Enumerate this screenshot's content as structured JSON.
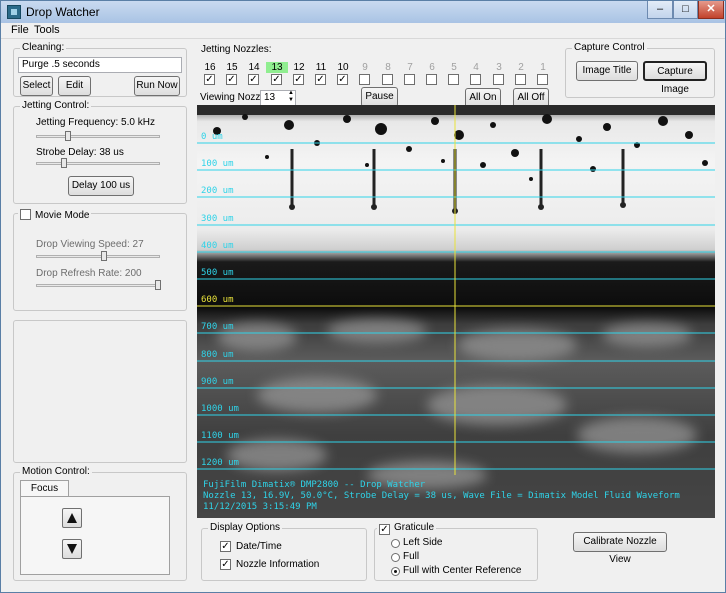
{
  "window": {
    "title": "Drop Watcher",
    "min": "–",
    "max": "□",
    "close": "✕",
    "icon": "app-icon"
  },
  "menu": [
    "File",
    "Tools"
  ],
  "cleaning": {
    "title": "Cleaning:",
    "value": "Purge .5 seconds",
    "select": "Select",
    "edit": "Edit",
    "run_now": "Run Now"
  },
  "jetting_control": {
    "title": "Jetting Control:",
    "frequency_label": "Jetting Frequency:  5.0 kHz",
    "strobe_label": "Strobe Delay:  38 us",
    "delay_button": "Delay 100 us"
  },
  "movie_mode": {
    "title": "Movie Mode",
    "checked": false,
    "speed_label": "Drop Viewing Speed:  27",
    "refresh_label": "Drop Refresh Rate:  200"
  },
  "motion_control": {
    "title": "Motion Control:",
    "tab": "Focus",
    "up_icon": "arrow-up-icon",
    "down_icon": "arrow-down-icon"
  },
  "jetting_nozzles": {
    "title": "Jetting Nozzles:",
    "nozzles": [
      {
        "num": "16",
        "checked": true,
        "enabled": true,
        "selected": false
      },
      {
        "num": "15",
        "checked": true,
        "enabled": true,
        "selected": false
      },
      {
        "num": "14",
        "checked": true,
        "enabled": true,
        "selected": false
      },
      {
        "num": "13",
        "checked": true,
        "enabled": true,
        "selected": true
      },
      {
        "num": "12",
        "checked": true,
        "enabled": true,
        "selected": false
      },
      {
        "num": "11",
        "checked": true,
        "enabled": true,
        "selected": false
      },
      {
        "num": "10",
        "checked": true,
        "enabled": true,
        "selected": false
      },
      {
        "num": "9",
        "checked": false,
        "enabled": false,
        "selected": false
      },
      {
        "num": "8",
        "checked": false,
        "enabled": false,
        "selected": false
      },
      {
        "num": "7",
        "checked": false,
        "enabled": false,
        "selected": false
      },
      {
        "num": "6",
        "checked": false,
        "enabled": false,
        "selected": false
      },
      {
        "num": "5",
        "checked": false,
        "enabled": false,
        "selected": false
      },
      {
        "num": "4",
        "checked": false,
        "enabled": false,
        "selected": false
      },
      {
        "num": "3",
        "checked": false,
        "enabled": false,
        "selected": false
      },
      {
        "num": "2",
        "checked": false,
        "enabled": false,
        "selected": false
      },
      {
        "num": "1",
        "checked": false,
        "enabled": false,
        "selected": false
      }
    ],
    "viewing_label": "Viewing Nozzle:",
    "viewing_value": "13",
    "pause": "Pause",
    "all_on": "All On",
    "all_off": "All Off"
  },
  "capture_control": {
    "title": "Capture Control",
    "image_title": "Image Title",
    "capture_image": "Capture Image"
  },
  "viewer": {
    "graticule_labels": [
      "0 um",
      "100 um",
      "200 um",
      "300 um",
      "400 um",
      "500 um",
      "600 um",
      "700 um",
      "800 um",
      "900 um",
      "1000 um",
      "1100 um",
      "1200 um"
    ],
    "highlight_label": "600 um",
    "overlay_lines": [
      "FujiFilm Dimatix® DMP2800 -- Drop Watcher",
      "Nozzle 13, 16.9V, 50.0°C, Strobe Delay = 38 us, Wave File = Dimatix Model Fluid Waveform",
      "11/12/2015 3:15:49 PM"
    ],
    "line_color": "#2fd3e8",
    "center_color": "#e8e23a"
  },
  "display_options": {
    "title": "Display Options",
    "datetime": "Date/Time",
    "datetime_checked": true,
    "nozzle_info": "Nozzle Information",
    "nozzle_info_checked": true
  },
  "graticule": {
    "title": "Graticule",
    "checked": true,
    "left_side": "Left Side",
    "full": "Full",
    "full_center": "Full with Center Reference",
    "selected": "full_center"
  },
  "calibrate": "Calibrate Nozzle View"
}
